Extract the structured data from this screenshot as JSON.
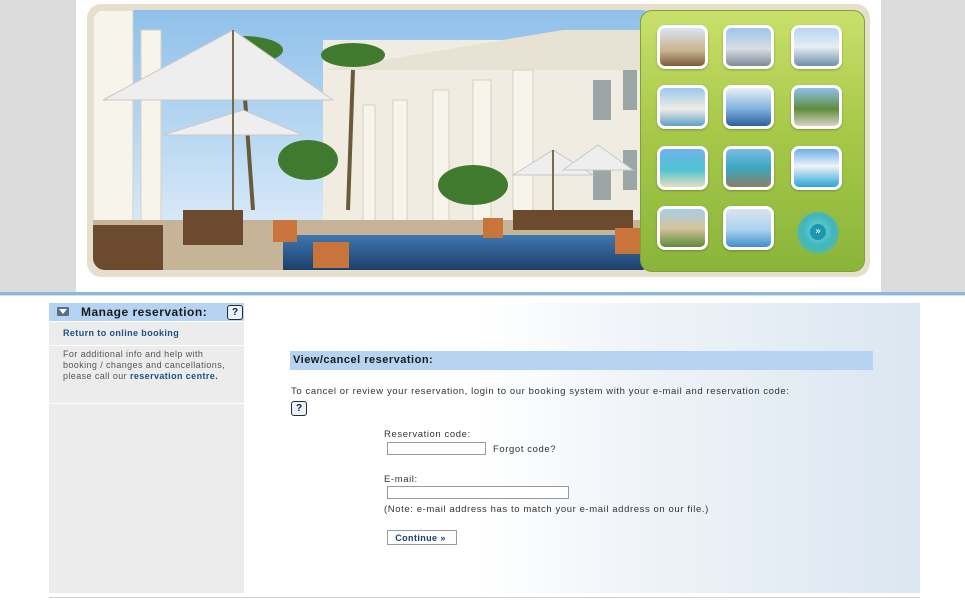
{
  "banner": {
    "thumbnails": [
      {
        "icon": "hotel-pool-photo-icon"
      },
      {
        "icon": "city-tower-photo-icon"
      },
      {
        "icon": "bridge-photo-icon"
      },
      {
        "icon": "hotel-building-photo-icon"
      },
      {
        "icon": "lifebuoy-photo-icon"
      },
      {
        "icon": "palm-resort-photo-icon"
      },
      {
        "icon": "sea-beach-photo-icon"
      },
      {
        "icon": "rocky-coast-photo-icon"
      },
      {
        "icon": "resort-pool-photo-icon"
      },
      {
        "icon": "garden-villa-photo-icon"
      },
      {
        "icon": "poolside-photo-icon"
      }
    ],
    "next_icon": "chevron-right-icon",
    "next_glyph": "»",
    "accent_color": "#a8c94a"
  },
  "sidebar": {
    "title": "Manage reservation:",
    "help_glyph": "?",
    "return_link": "Return to online booking",
    "info_text": "For additional info and help with booking / changes and cancellations, please call our",
    "info_link": "reservation centre."
  },
  "main": {
    "panel_title": "View/cancel reservation:",
    "intro": "To cancel or review your reservation, login to our booking system with your e-mail and reservation code:",
    "help_glyph": "?",
    "reservation_code_label": "Reservation code:",
    "reservation_code_value": "",
    "forgot_code": "Forgot code?",
    "email_label": "E-mail:",
    "email_value": "",
    "note": "(Note: e-mail address has to match your e-mail address on our file.)",
    "continue_label": "Continue »"
  },
  "colors": {
    "header_blue": "#b6d4f2",
    "link_blue": "#1c4f8c",
    "divider_blue": "#8fb7dc"
  }
}
